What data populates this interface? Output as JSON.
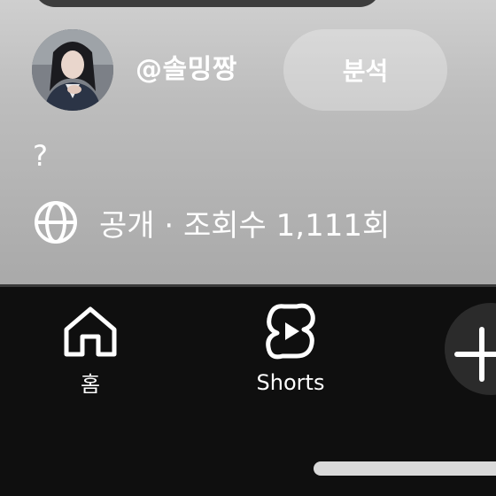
{
  "channel": {
    "handle": "@솔밍짱",
    "avatar": "avatar-photo"
  },
  "actions": {
    "analytics_label": "분석"
  },
  "video": {
    "description": "?",
    "meta": "공개 · 조회수 1,111회",
    "visibility_icon": "globe-icon"
  },
  "nav": {
    "home_label": "홈",
    "home_icon": "home-icon",
    "shorts_label": "Shorts",
    "shorts_icon": "shorts-icon",
    "create_icon": "plus-icon"
  },
  "colors": {
    "nav_background": "#0f0f0f",
    "overlay_gray": "#b5b5b5",
    "text": "#ffffff"
  }
}
